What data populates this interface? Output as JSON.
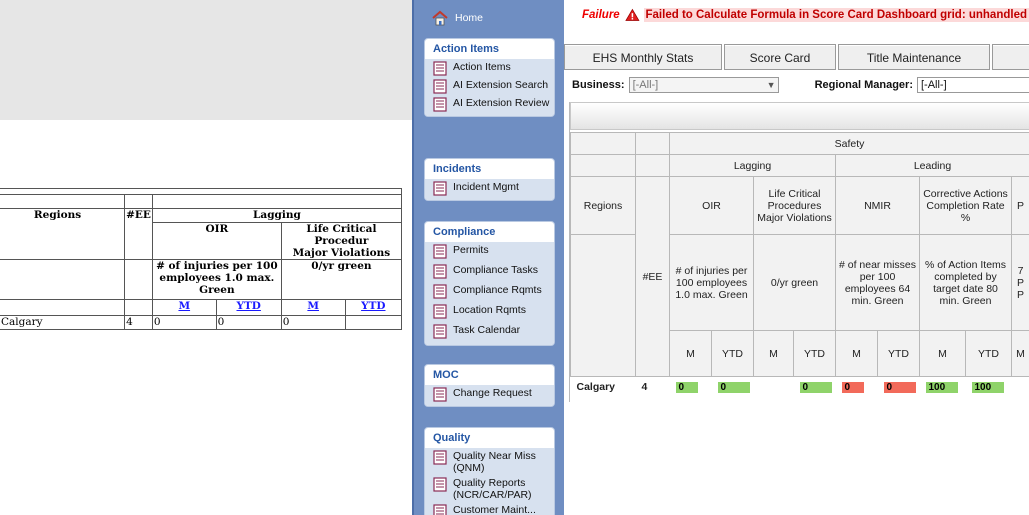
{
  "left_report": {
    "headers": {
      "regions": "Regions",
      "ee": "#EE",
      "lagging": "Lagging",
      "oir": "OIR",
      "lcpmv": "Life Critical Procedur",
      "lcpmv2": "Major Violations",
      "oir_desc": "# of injuries per 100 employees 1.0 max. Green",
      "lcpmv_desc": "0/yr green",
      "m": "M",
      "ytd": "YTD"
    },
    "row": {
      "region": "Calgary",
      "ee": "4",
      "oir_m": "0",
      "oir_ytd": "0",
      "lc_m": "0"
    }
  },
  "sidebar": {
    "home_label": "Home",
    "groups": [
      {
        "title": "Action Items",
        "items": [
          "Action Items",
          "AI Extension Search",
          "AI Extension Review"
        ]
      },
      {
        "title": "Incidents",
        "items": [
          "Incident Mgmt"
        ]
      },
      {
        "title": "Compliance",
        "items": [
          "Permits",
          "Compliance Tasks",
          "Compliance Rqmts",
          "Location Rqmts",
          "Task Calendar"
        ]
      },
      {
        "title": "MOC",
        "items": [
          "Change Request"
        ]
      },
      {
        "title": "Quality",
        "items": [
          "Quality Near Miss (QNM)",
          "Quality Reports (NCR/CAR/PAR)",
          "Customer Maint..."
        ]
      }
    ]
  },
  "error": {
    "failure": "Failure",
    "message": "Failed to Calculate Formula in Score Card Dashboard grid: unhandled"
  },
  "tabs": [
    "EHS Monthly Stats",
    "Score Card",
    "Title Maintenance"
  ],
  "filters": {
    "business_label": "Business:",
    "business_value": "[-All-]",
    "regional_manager_label": "Regional Manager:",
    "regional_manager_value": "[-All-]"
  },
  "grid": {
    "safety": "Safety",
    "lagging": "Lagging",
    "leading": "Leading",
    "regions": "Regions",
    "ee": "#EE",
    "oir": "OIR",
    "lcp": "Life Critical Procedures Major Violations",
    "nmir": "NMIR",
    "cacr": "Corrective Actions Completion Rate %",
    "p_partial": "P",
    "oir_desc": "# of injuries per 100 employees 1.0 max. Green",
    "lcp_desc": "0/yr green",
    "nmir_desc": "# of near misses per 100 employees 64 min. Green",
    "cacr_desc": "% of Action Items completed by target date 80 min. Green",
    "p_desc_partial": "7 P P",
    "m": "M",
    "ytd": "YTD",
    "row": {
      "region": "Calgary",
      "ee": "4",
      "oir_m": "0",
      "oir_ytd": "0",
      "lcp_ytd": "0",
      "nmir_m": "0",
      "nmir_ytd": "0",
      "cacr_m": "100",
      "cacr_ytd": "100"
    }
  },
  "colors": {
    "green": "#8fd36a",
    "red": "#f26a5a",
    "sidebar": "#6f8ec2",
    "group_title": "#2456a4"
  }
}
